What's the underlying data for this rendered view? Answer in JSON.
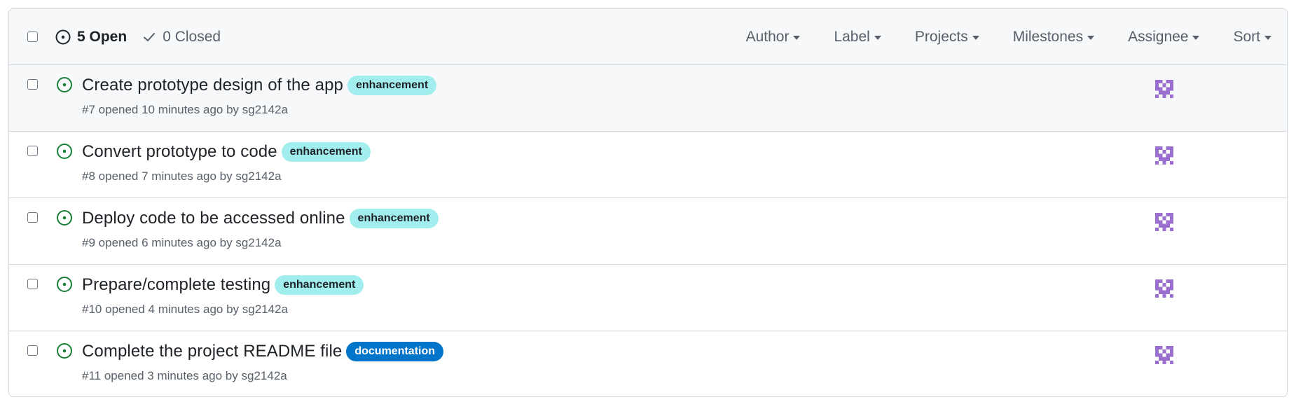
{
  "header": {
    "open_label": "5 Open",
    "closed_label": "0 Closed",
    "filters": [
      "Author",
      "Label",
      "Projects",
      "Milestones",
      "Assignee",
      "Sort"
    ]
  },
  "colors": {
    "open_icon": "#1a7f37",
    "enhancement_bg": "#a2eeef",
    "enhancement_fg": "#1f2328",
    "documentation_bg": "#0075ca",
    "documentation_fg": "#ffffff",
    "avatar": "#9b6fd0"
  },
  "issues": [
    {
      "title": "Create prototype design of the app",
      "label": "enhancement",
      "number": "#7",
      "opened": "opened 10 minutes ago by",
      "author": "sg2142a",
      "avatar_icon": "identicon"
    },
    {
      "title": "Convert prototype to code",
      "label": "enhancement",
      "number": "#8",
      "opened": "opened 7 minutes ago by",
      "author": "sg2142a",
      "avatar_icon": "identicon"
    },
    {
      "title": "Deploy code to be accessed online",
      "label": "enhancement",
      "number": "#9",
      "opened": "opened 6 minutes ago by",
      "author": "sg2142a",
      "avatar_icon": "identicon"
    },
    {
      "title": "Prepare/complete testing",
      "label": "enhancement",
      "number": "#10",
      "opened": "opened 4 minutes ago by",
      "author": "sg2142a",
      "avatar_icon": "identicon"
    },
    {
      "title": "Complete the project README file",
      "label": "documentation",
      "number": "#11",
      "opened": "opened 3 minutes ago by",
      "author": "sg2142a",
      "avatar_icon": "identicon"
    }
  ]
}
